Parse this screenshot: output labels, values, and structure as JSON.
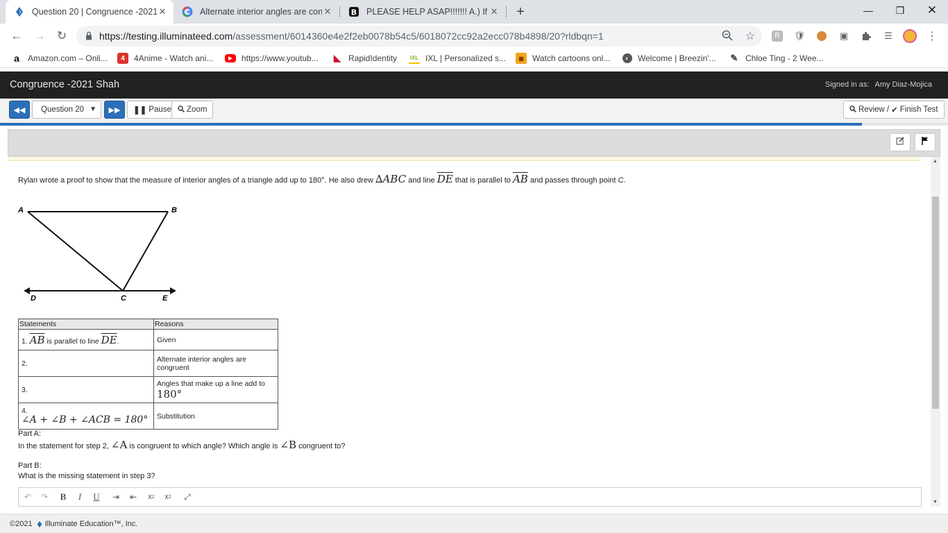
{
  "browser": {
    "tabs": [
      {
        "title": "Question 20 | Congruence -2021"
      },
      {
        "title": "Alternate interior angles are cong"
      },
      {
        "title": "PLEASE HELP ASAP!!!!!!! A.) If two"
      }
    ],
    "url_host": "https://testing.illuminateed.com",
    "url_path": "/assessment/6014360e4e2f2eb0078b54c5/6018072cc92a2ecc078b4898/20?rldbqn=1",
    "bookmarks": [
      {
        "label": "Amazon.com – Onli...",
        "icon": "amazon-icon"
      },
      {
        "label": "4Anime - Watch ani...",
        "icon": "4anime-icon"
      },
      {
        "label": "https://www.youtub...",
        "icon": "youtube-icon"
      },
      {
        "label": "RapidIdentity",
        "icon": "rapididentity-icon"
      },
      {
        "label": "IXL | Personalized s...",
        "icon": "ixl-icon"
      },
      {
        "label": "Watch cartoons onl...",
        "icon": "cartoons-icon"
      },
      {
        "label": "Welcome | Breezin'...",
        "icon": "breezin-icon"
      },
      {
        "label": "Chloe Ting - 2 Wee...",
        "icon": "chloe-ting-icon"
      }
    ]
  },
  "app": {
    "title": "Congruence -2021 Shah",
    "signed_in_label": "Signed in as:",
    "user": "Amy Diaz-Mojica",
    "question_select": "Question 20",
    "pause": "Pause",
    "zoom": "Zoom",
    "review": "Review /",
    "finish": "Finish Test",
    "progress_fraction": 0.909
  },
  "question": {
    "intro_a": "Rylan wrote a proof to show that the measure of interior angles of a triangle add up to 180°. He also drew ",
    "triangle": "∆ABC",
    "intro_b": " and line ",
    "line_de": "DE",
    "intro_c": " that is parallel to ",
    "line_ab": "AB",
    "intro_d": " and passes through point ",
    "point_c": "C",
    "intro_e": ".",
    "diagram_labels": {
      "A": "A",
      "B": "B",
      "C": "C",
      "D": "D",
      "E": "E"
    },
    "table": {
      "headers": [
        "Statements",
        "Reasons"
      ],
      "rows": [
        {
          "num": "1.",
          "stmt_ab": "AB",
          "stmt_mid": " is parallel to line ",
          "stmt_de": "DE",
          "stmt_end": ".",
          "reason": "Given"
        },
        {
          "num": "2.",
          "reason": "Alternate interior angles are congruent"
        },
        {
          "num": "3.",
          "reason": "Angles that make up a line add to",
          "reason_math": "180°"
        },
        {
          "num": "4.",
          "stmt_math": "∠A + ∠B + ∠ACB = 180°",
          "reason": "Substitution"
        }
      ]
    },
    "part_a_label": "Part A:",
    "part_a_pre": "In the statement for step 2, ",
    "angle_a": "∠A",
    "part_a_mid": " is congruent to which angle? Which angle is ",
    "angle_b": "∠B",
    "part_a_post": " congruent to?",
    "part_b_label": "Part B:",
    "part_b_text": "What is the missing statement in step 3?"
  },
  "footer": {
    "copyright": "©2021",
    "company": "Illuminate Education™, Inc."
  }
}
